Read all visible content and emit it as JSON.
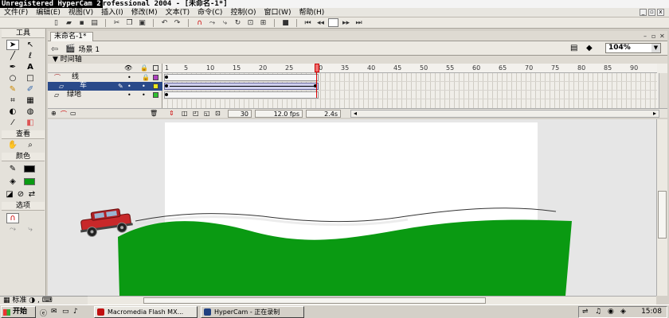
{
  "window_title_prefix": "Unregistered HyperCam 2",
  "window_title": "rofessional 2004 - [未命名-1*]",
  "menu": [
    "文件(F)",
    "编辑(E)",
    "视图(V)",
    "插入(I)",
    "修改(M)",
    "文本(T)",
    "命令(C)",
    "控制(O)",
    "窗口(W)",
    "帮助(H)"
  ],
  "mdi_buttons": [
    "_",
    "▫",
    "x"
  ],
  "tools_panel": {
    "title": "工具",
    "view_label": "查看",
    "colors_label": "颜色",
    "options_label": "选项"
  },
  "document_tab": "未命名-1*",
  "scene_label": "场景 1",
  "zoom": "104%",
  "timeline_label": "时间轴",
  "layers": [
    {
      "name": "线",
      "icon": "mask-layer-icon",
      "selected": false
    },
    {
      "name": "车",
      "icon": "layer-icon",
      "selected": true
    },
    {
      "name": "绿地",
      "icon": "layer-icon",
      "selected": false
    }
  ],
  "frame_ticks": [
    "1",
    "5",
    "10",
    "15",
    "20",
    "25",
    "30",
    "35",
    "40",
    "45",
    "50",
    "55",
    "60",
    "65",
    "70",
    "75",
    "80",
    "85",
    "90"
  ],
  "timeline_status": {
    "current_frame": "30",
    "fps": "12.0 fps",
    "elapsed": "2.4s"
  },
  "status_left": "标准",
  "taskbar": {
    "start": "开始",
    "tasks": [
      "Macromedia Flash MX...",
      "HyperCam - 正在录制"
    ],
    "clock": "15:08"
  },
  "colors": {
    "grass": "#0a9a12",
    "car": "#c8282a",
    "selected_layer": "#2a4a8a"
  }
}
